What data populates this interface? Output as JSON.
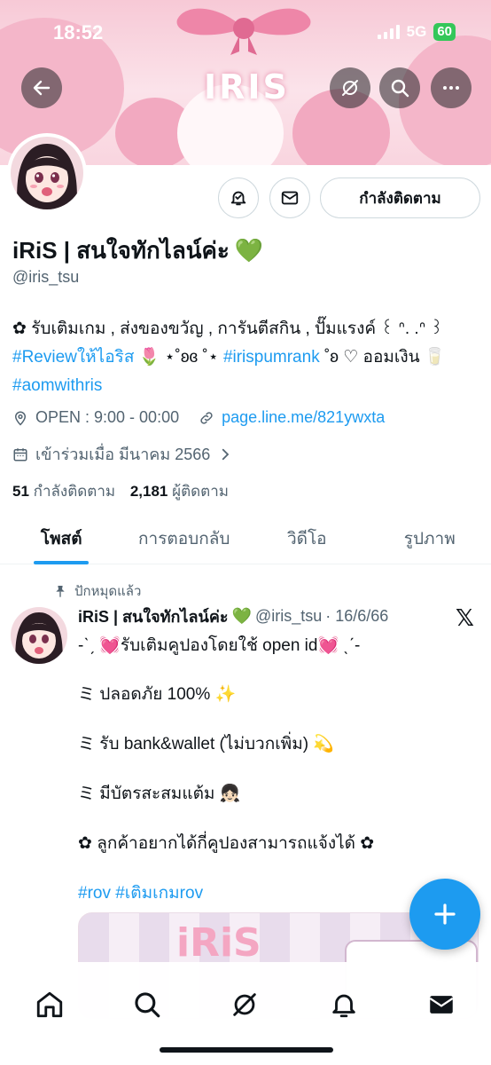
{
  "status_bar": {
    "time": "18:52",
    "network": "5G",
    "battery": "60"
  },
  "banner": {
    "brand_text": "IRIS"
  },
  "profile": {
    "display_name": "iRiS | สนใจทักไลน์ค่ะ",
    "name_emoji": "💚",
    "handle": "@iris_tsu",
    "follow_button_label": "กำลังติดตาม",
    "bio": {
      "line1": "✿ รับเติมเกม , ส่งของขวัญ , การันตีสกิน , ปั๊มแรงค์ ꒰ ᐢ. .ᐢ ꒱",
      "tag1": "#Reviewให้ไอริส",
      "mid1": " 🌷 ⋆˚ʚɞ ˚⋆ ",
      "tag2": "#irispumrank",
      "mid2": " ˚ʚ ♡ ออมเงิน 🥛 ",
      "tag3": "#aomwithris"
    },
    "location": "OPEN : 9:00 - 00:00",
    "link": "page.line.me/821ywxta",
    "joined": "เข้าร่วมเมื่อ มีนาคม 2566",
    "following_count": "51",
    "following_label": "กำลังติดตาม",
    "followers_count": "2,181",
    "followers_label": "ผู้ติดตาม"
  },
  "tabs": [
    {
      "label": "โพสต์",
      "active": true
    },
    {
      "label": "การตอบกลับ",
      "active": false
    },
    {
      "label": "วิดีโอ",
      "active": false
    },
    {
      "label": "รูปภาพ",
      "active": false
    }
  ],
  "pinned_post": {
    "pinned_label": "ปักหมุดแล้ว",
    "author_name": "iRiS | สนใจทักไลน์ค่ะ",
    "author_emoji": "💚",
    "author_handle": "@iris_tsu",
    "date": "· 16/6/66",
    "lines": [
      "-ˋˏ 💓รับเติมคูปองโดยใช้ open id💓 ˎˊ-",
      "ミ ปลอดภัย 100% ✨",
      "ミ รับ bank&wallet (ไม่บวกเพิ่ม) 💫",
      "ミ มีบัตรสะสมแต้ม 👧🏻",
      "✿ ลูกค้าอยากได้กี่คูปองสามารถแจ้งได้ ✿"
    ],
    "hashtags": "#rov #เติมเกมrov",
    "media_text": "iRiS"
  },
  "colors": {
    "accent": "#1d9bf0",
    "banner_pink": "#f7c9d6",
    "verified_green": "#34c759"
  },
  "icons": [
    "back-arrow-icon",
    "grok-icon",
    "search-icon",
    "more-icon",
    "notification-bell-icon",
    "mail-icon",
    "location-icon",
    "link-icon",
    "calendar-icon",
    "chevron-right-icon",
    "pin-icon",
    "x-logo-icon",
    "plus-icon",
    "home-icon",
    "explore-icon",
    "grok-nav-icon",
    "notifications-icon",
    "messages-icon"
  ]
}
